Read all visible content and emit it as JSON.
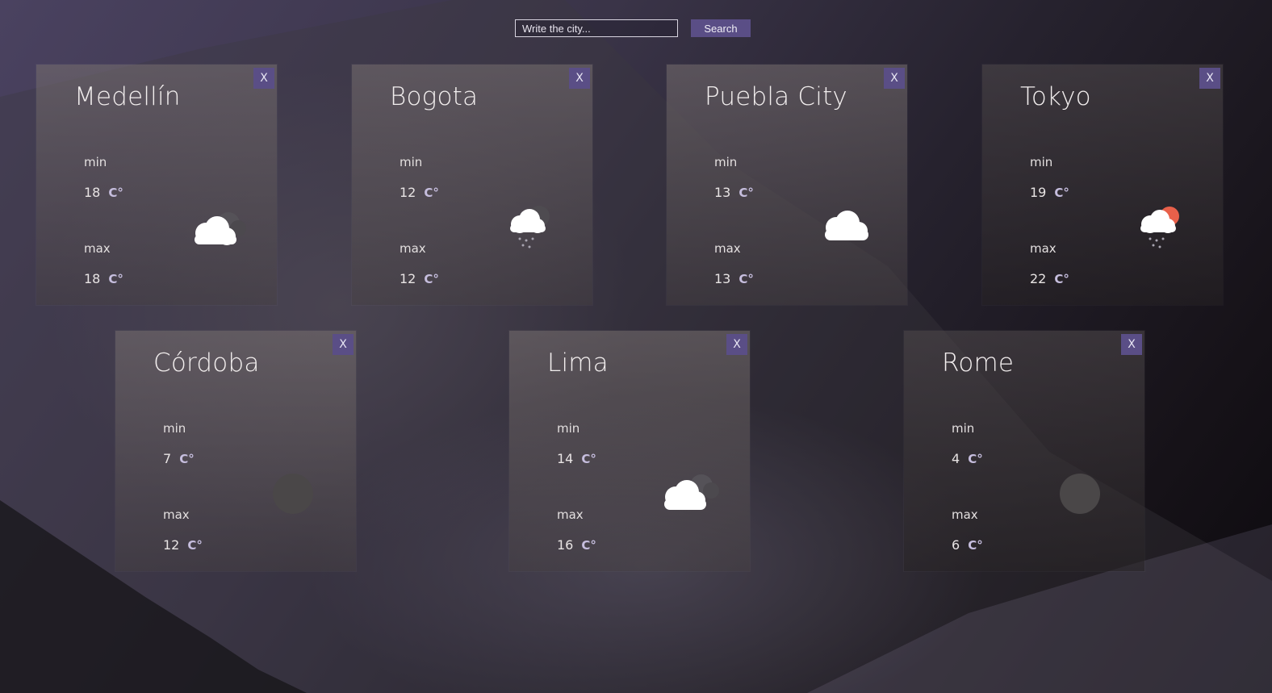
{
  "search": {
    "placeholder": "Write the city...",
    "button_label": "Search"
  },
  "close_label": "X",
  "min_label": "min",
  "max_label": "max",
  "unit": "C°",
  "cards": [
    {
      "city": "Medellín",
      "min": "18",
      "max": "18",
      "icon": "cloudy-overcast-icon"
    },
    {
      "city": "Bogota",
      "min": "12",
      "max": "12",
      "icon": "cloud-rain-icon"
    },
    {
      "city": "Puebla City",
      "min": "13",
      "max": "13",
      "icon": "cloud-icon"
    },
    {
      "city": "Tokyo",
      "min": "19",
      "max": "22",
      "icon": "sun-rain-cloud-icon"
    },
    {
      "city": "Córdoba",
      "min": "7",
      "max": "12",
      "icon": "moon-icon"
    },
    {
      "city": "Lima",
      "min": "14",
      "max": "16",
      "icon": "cloudy-overcast-icon"
    },
    {
      "city": "Rome",
      "min": "4",
      "max": "6",
      "icon": "moon-icon"
    }
  ]
}
